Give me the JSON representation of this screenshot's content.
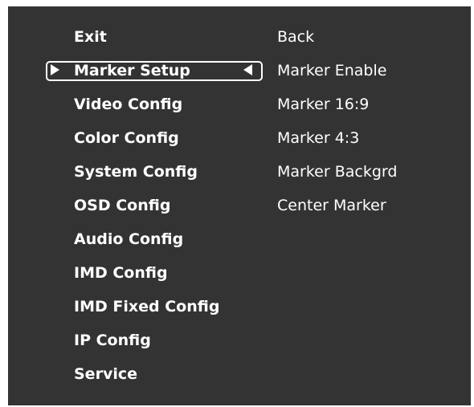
{
  "menu": {
    "items": [
      {
        "label": "Exit"
      },
      {
        "label": "Marker Setup"
      },
      {
        "label": "Video Config"
      },
      {
        "label": "Color Config"
      },
      {
        "label": "System Config"
      },
      {
        "label": "OSD Config"
      },
      {
        "label": "Audio Config"
      },
      {
        "label": "IMD Config"
      },
      {
        "label": "IMD Fixed Config"
      },
      {
        "label": "IP Config"
      },
      {
        "label": "Service"
      }
    ],
    "selected_label": "Marker Setup"
  },
  "submenu": {
    "items": [
      {
        "label": "Back"
      },
      {
        "label": "Marker Enable"
      },
      {
        "label": "Marker 16:9"
      },
      {
        "label": "Marker 4:3"
      },
      {
        "label": "Marker Backgrd"
      },
      {
        "label": "Center Marker"
      }
    ]
  },
  "colors": {
    "background": "#333333",
    "text": "#ffffff",
    "border": "#ffffff"
  }
}
